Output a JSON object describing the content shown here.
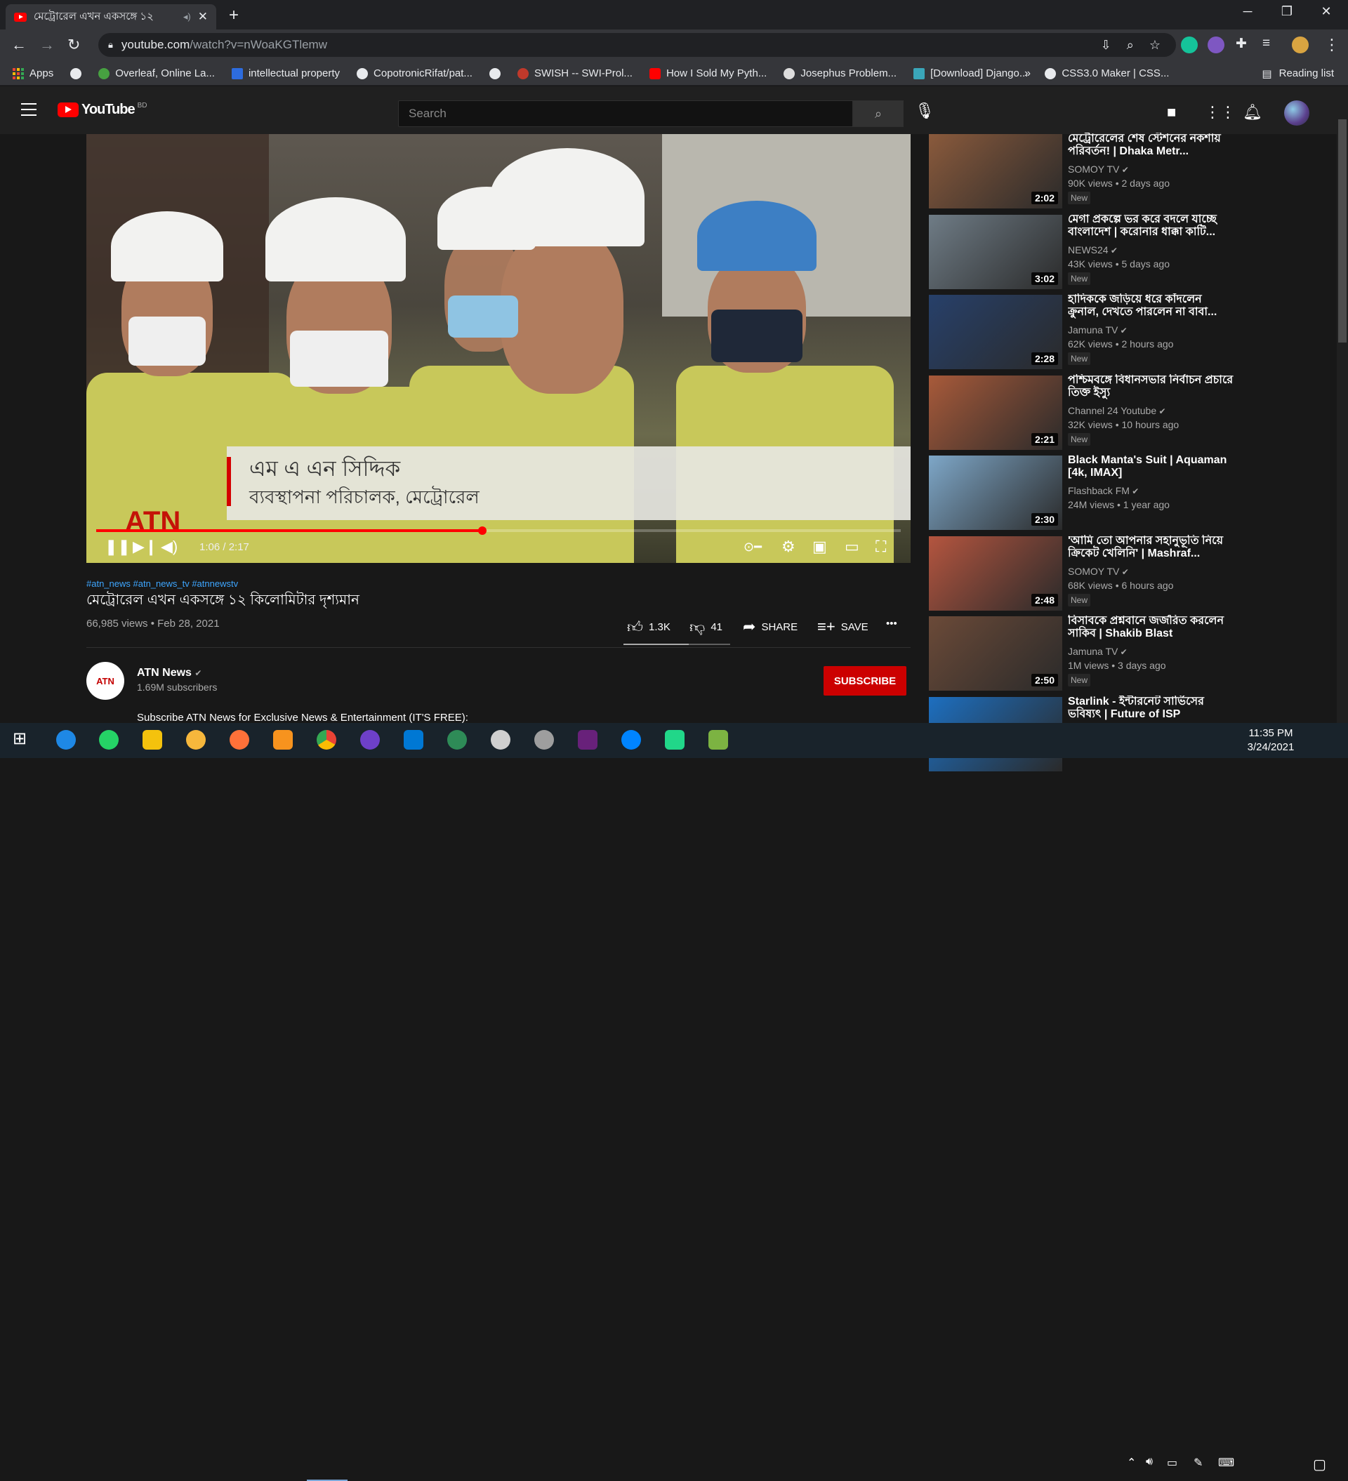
{
  "browser": {
    "tab_title": "মেট্রোরেল এখন একসঙ্গে ১২ ",
    "url_host": "youtube.com",
    "url_path": "/watch?v=nWoaKGTlemw",
    "bookmarks": [
      {
        "label": "Apps"
      },
      {
        "label": ""
      },
      {
        "label": "Overleaf, Online La..."
      },
      {
        "label": "intellectual property"
      },
      {
        "label": "CopotronicRifat/pat..."
      },
      {
        "label": ""
      },
      {
        "label": "SWISH -- SWI-Prol..."
      },
      {
        "label": "How I Sold My Pyth..."
      },
      {
        "label": "Josephus Problem..."
      },
      {
        "label": "[Download] Django..."
      },
      {
        "label": "CSS3.0 Maker | CSS..."
      }
    ],
    "more": "»",
    "reading_list": "Reading list"
  },
  "youtube": {
    "logo_text": "YouTube",
    "country_code": "BD",
    "search_placeholder": "Search"
  },
  "video": {
    "lower_third_name": "এম এ এন সিদ্দিক",
    "lower_third_role": "ব্যবস্থাপনা পরিচালক, মেট্রোরেল",
    "time": "1:06 / 2:17",
    "progress": 0.48,
    "overlay_logo": "ATN"
  },
  "details": {
    "hashtags": "#atn_news #atn_news_tv #atnnewstv",
    "title": "মেট্রোরেল এখন একসঙ্গে ১২ কিলোমিটার দৃশ্যমান",
    "meta": "66,985 views • Feb 28, 2021",
    "likes": "1.3K",
    "dislikes": "41",
    "share": "SHARE",
    "save": "SAVE",
    "more": "•••"
  },
  "channel": {
    "name": "ATN News",
    "subscribers": "1.69M subscribers",
    "subscribe": "SUBSCRIBE",
    "description": "Subscribe ATN News for Exclusive News & Entertainment (IT'S FREE):",
    "avatar_text": "ATN"
  },
  "sidebar": [
    {
      "title": "মেট্রোরেলের শেষ স্টেশনের নকশায় পরিবর্তন! | Dhaka Metr...",
      "channel": "SOMOY TV",
      "meta": "90K views • 2 days ago",
      "badge": "New",
      "duration": "2:02",
      "color": "#8a5a3c"
    },
    {
      "title": "মেগা প্রকল্পে ভর করে বদলে যাচ্ছে বাংলাদেশ | করোনার ধাক্কা কাটি...",
      "channel": "NEWS24",
      "meta": "43K views • 5 days ago",
      "badge": "New",
      "duration": "3:02",
      "color": "#6f7c86"
    },
    {
      "title": "হাদিককে জড়িয়ে ধরে কাঁদলেন ক্রুনাল, দেখতে পারলেন না বাবা...",
      "channel": "Jamuna TV",
      "meta": "62K views • 2 hours ago",
      "badge": "New",
      "duration": "2:28",
      "color": "#27406a"
    },
    {
      "title": "পশ্চিমবঙ্গে বিধানসভার নির্বাচন প্রচারে তিক্ত ইস্যু",
      "channel": "Channel 24 Youtube",
      "meta": "32K views • 10 hours ago",
      "badge": "New",
      "duration": "2:21",
      "color": "#a85a3a"
    },
    {
      "title": "Black Manta's Suit | Aquaman [4k, IMAX]",
      "channel": "Flashback FM",
      "meta": "24M views • 1 year ago",
      "badge": "",
      "duration": "2:30",
      "color": "#7ea7c8"
    },
    {
      "title": "'আমি তো আপনার সহানুভূতি নিয়ে ক্রিকেট খেলিনি' | Mashraf...",
      "channel": "SOMOY TV",
      "meta": "68K views • 6 hours ago",
      "badge": "New",
      "duration": "2:48",
      "color": "#b4553f"
    },
    {
      "title": "বিসাবকে প্রশ্নবানে জর্জরিত করলেন সাকিব | Shakib Blast",
      "channel": "Jamuna TV",
      "meta": "1M views • 3 days ago",
      "badge": "New",
      "duration": "2:50",
      "color": "#6b4a38"
    },
    {
      "title": "Starlink - ইন্টারনেট সার্ভিসের ভবিষ্যৎ | Future of ISP",
      "channel": "",
      "meta": "",
      "badge": "",
      "duration": "",
      "color": "#1d6fc0"
    }
  ],
  "taskbar": {
    "time": "11:35 PM",
    "date": "3/24/2021"
  }
}
